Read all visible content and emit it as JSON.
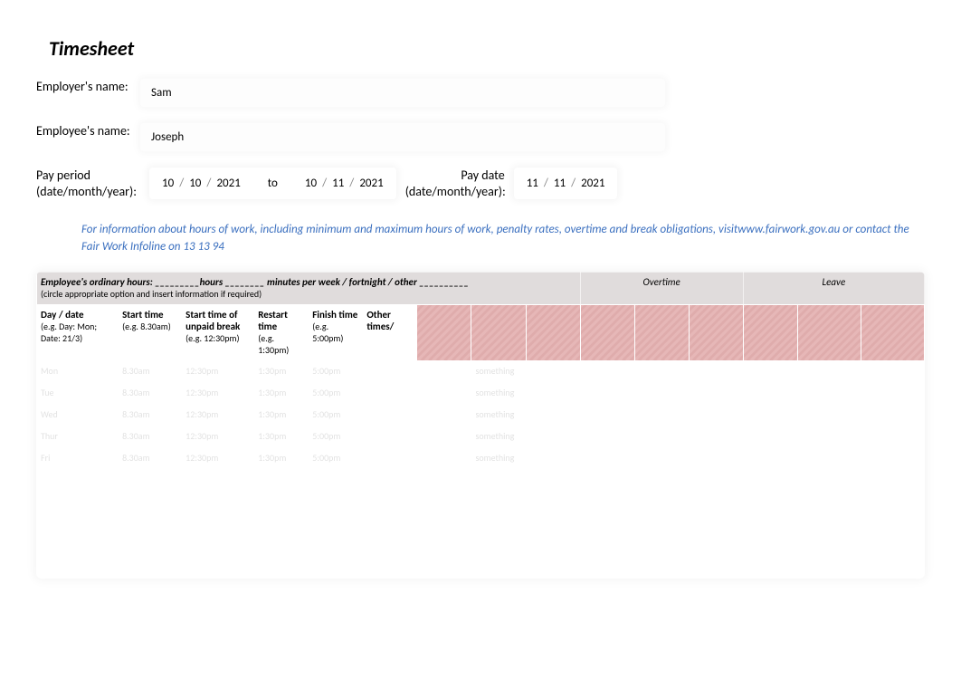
{
  "title": "Timesheet",
  "labels": {
    "employer": "Employer's name:",
    "employee": "Employee's name:",
    "payPeriod": "Pay period (date/month/year):",
    "to": "to",
    "payDate": "Pay date (date/month/year):"
  },
  "employerName": "Sam",
  "employeeName": "Joseph",
  "period": {
    "from": {
      "d": "10",
      "m": "10",
      "y": "2021"
    },
    "to": {
      "d": "10",
      "m": "11",
      "y": "2021"
    }
  },
  "payDate": {
    "d": "11",
    "m": "11",
    "y": "2021"
  },
  "sep": "/",
  "info": {
    "line1a": "For information about hours of work, including minimum and maximum hours of work, penalty rates, overtime and break obligations, visit",
    "link": "www.fairwork.gov.au",
    "line1b": " or contact the",
    "line2": "Fair Work Infoline on 13 13 94"
  },
  "tableHead": {
    "ordHours": {
      "bold": "Employee's ordinary hours: _________hours ________ minutes per week / fortnight / other __________",
      "sub": "(circle appropriate option and insert information if required)"
    },
    "overtime": "Overtime",
    "leave": "Leave"
  },
  "cols": {
    "dayDate": {
      "h": "Day / date",
      "ex": "(e.g. Day: Mon; Date: 21/3)"
    },
    "start": {
      "h": "Start time",
      "ex": "(e.g. 8.30am)"
    },
    "breakStart": {
      "h": "Start time of unpaid break",
      "ex": "(e.g. 12:30pm)"
    },
    "restart": {
      "h": "Restart time",
      "ex": "(e.g. 1:30pm)"
    },
    "finish": {
      "h": "Finish time",
      "ex": "(e.g. 5:00pm)"
    },
    "other": {
      "h": "Other times/",
      "ex": ""
    }
  },
  "rows": [
    {
      "day": "Mon",
      "start": "8.30am",
      "bstart": "12:30pm",
      "restart": "1:30pm",
      "finish": "5:00pm",
      "r5": "something"
    },
    {
      "day": "Tue",
      "start": "8.30am",
      "bstart": "12:30pm",
      "restart": "1:30pm",
      "finish": "5:00pm",
      "r5": "something"
    },
    {
      "day": "Wed",
      "start": "8.30am",
      "bstart": "12:30pm",
      "restart": "1:30pm",
      "finish": "5:00pm",
      "r5": "something"
    },
    {
      "day": "Thur",
      "start": "8.30am",
      "bstart": "12:30pm",
      "restart": "1:30pm",
      "finish": "5:00pm",
      "r5": "something"
    },
    {
      "day": "Fri",
      "start": "8.30am",
      "bstart": "12:30pm",
      "restart": "1:30pm",
      "finish": "5:00pm",
      "r5": "something"
    }
  ]
}
